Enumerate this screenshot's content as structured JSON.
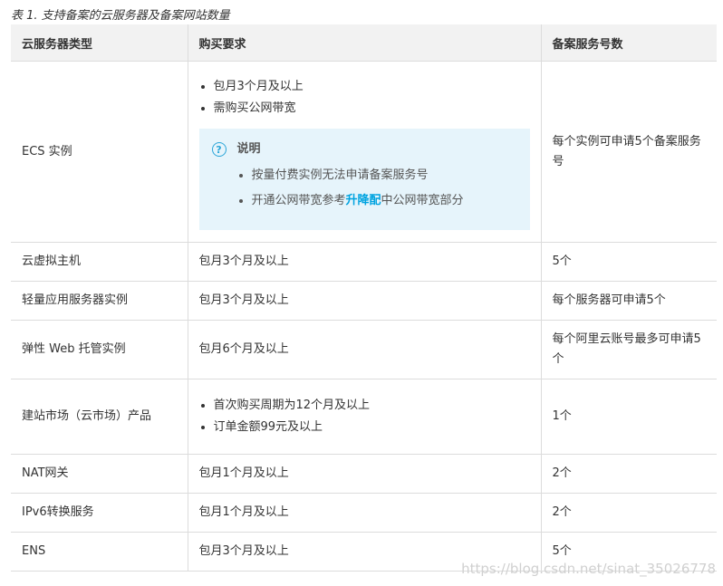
{
  "caption": "表 1. 支持备案的云服务器及备案网站数量",
  "headers": [
    "云服务器类型",
    "购买要求",
    "备案服务号数"
  ],
  "rows": {
    "ecs": {
      "type": "ECS 实例",
      "reqs": [
        "包月3个月及以上",
        "需购买公网带宽"
      ],
      "note_title": "说明",
      "note_items": {
        "first": "按量付费实例无法申请备案服务号",
        "second_prefix": "开通公网带宽参考",
        "second_link": "升降配",
        "second_suffix": "中公网带宽部分"
      },
      "count": "每个实例可申请5个备案服务号"
    },
    "vhost": {
      "type": "云虚拟主机",
      "req": "包月3个月及以上",
      "count": "5个"
    },
    "light": {
      "type": "轻量应用服务器实例",
      "req": "包月3个月及以上",
      "count": "每个服务器可申请5个"
    },
    "web": {
      "type": "弹性 Web 托管实例",
      "req": "包月6个月及以上",
      "count": "每个阿里云账号最多可申请5个"
    },
    "market": {
      "type": "建站市场（云市场）产品",
      "reqs": [
        "首次购买周期为12个月及以上",
        "订单金额99元及以上"
      ],
      "count": "1个"
    },
    "nat": {
      "type": "NAT网关",
      "req": "包月1个月及以上",
      "count": "2个"
    },
    "ipv6": {
      "type": "IPv6转换服务",
      "req": "包月1个月及以上",
      "count": "2个"
    },
    "ens": {
      "type": "ENS",
      "req": "包月3个月及以上",
      "count": "5个"
    }
  },
  "watermark": "https://blog.csdn.net/sinat_35026778"
}
